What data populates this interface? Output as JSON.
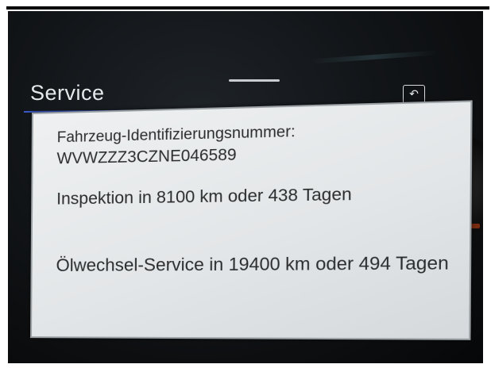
{
  "screen": {
    "title": "Service",
    "back_icon": "↶"
  },
  "service_info": {
    "vin_label": "Fahrzeug-Identifizierungsnummer:",
    "vin_value": "WVWZZZ3CZNE046589",
    "inspection": "Inspektion in 8100 km oder 438 Tagen",
    "oil_service": "Ölwechsel-Service in 19400 km oder 494 Tagen"
  },
  "colors": {
    "accent_line": "#3a58c8",
    "panel_bg": "#e6e9eb",
    "text": "#2a2c2e"
  }
}
